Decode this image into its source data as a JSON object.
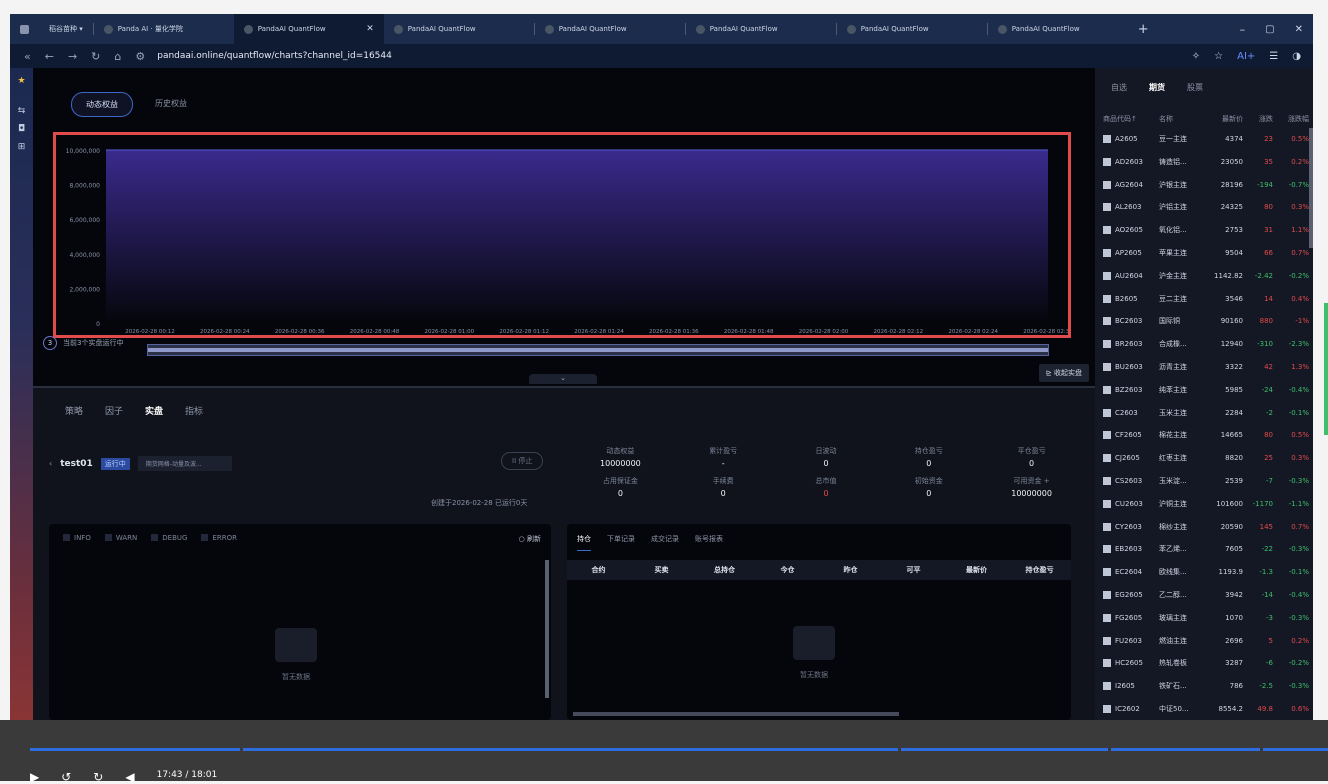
{
  "browser": {
    "tabs": [
      {
        "label": "稻谷苗种 ▾",
        "active": false
      },
      {
        "label": "Panda AI · 量化学院",
        "active": false
      },
      {
        "label": "PandaAI QuantFlow",
        "active": true
      },
      {
        "label": "PandaAI QuantFlow",
        "active": false
      },
      {
        "label": "PandaAI QuantFlow",
        "active": false
      },
      {
        "label": "PandaAI QuantFlow",
        "active": false
      },
      {
        "label": "PandaAI QuantFlow",
        "active": false
      },
      {
        "label": "PandaAI QuantFlow",
        "active": false
      }
    ],
    "url": "pandaai.online/quantflow/charts?channel_id=16544",
    "ai_label": "AI+"
  },
  "equity": {
    "toggle_dynamic": "动态权益",
    "toggle_history": "历史权益",
    "running_count": "3",
    "running_text": "当前3个实盘运行中",
    "collapse_btn": "收起实盘"
  },
  "chart_data": {
    "type": "area",
    "x": [
      "2026-02-28 00:12",
      "2026-02-28 00:24",
      "2026-02-28 00:36",
      "2026-02-28 00:48",
      "2026-02-28 01:00",
      "2026-02-28 01:12",
      "2026-02-28 01:24",
      "2026-02-28 01:36",
      "2026-02-28 01:48",
      "2026-02-28 02:00",
      "2026-02-28 02:12",
      "2026-02-28 02:24",
      "2026-02-28 02:36"
    ],
    "yticks": [
      "0",
      "2,000,000",
      "4,000,000",
      "6,000,000",
      "8,000,000",
      "10,000,000"
    ],
    "values": [
      10000000,
      10000000,
      10000000,
      10000000,
      10000000,
      10000000,
      10000000,
      10000000,
      10000000,
      10000000,
      10000000,
      10000000,
      10000000
    ],
    "ylim": [
      0,
      10000000
    ],
    "grid": false,
    "colors": {
      "fill_top": "#3a2a8c",
      "fill_bottom": "#05060b",
      "line": "#4a4fc0"
    }
  },
  "bottom": {
    "tabs": [
      "策略",
      "因子",
      "实盘",
      "指标"
    ],
    "active_tab": "实盘",
    "strategy_name": "test01",
    "status_badge": "运行中",
    "strategy_select": "期货网格-动量及波...",
    "stop_btn": "II 停止",
    "created": "创建于2026-02-28   已运行0天",
    "stats": [
      {
        "label": "动态权益",
        "value": "10000000",
        "red": false
      },
      {
        "label": "累计盈亏",
        "value": "-",
        "red": false
      },
      {
        "label": "日波动",
        "value": "0",
        "red": false
      },
      {
        "label": "持仓盈亏",
        "value": "0",
        "red": false
      },
      {
        "label": "平仓盈亏",
        "value": "0",
        "red": false
      },
      {
        "label": "占用保证金",
        "value": "0",
        "red": false
      },
      {
        "label": "手续费",
        "value": "0",
        "red": false
      },
      {
        "label": "总市值",
        "value": "0",
        "red": true
      },
      {
        "label": "初始资金",
        "value": "0",
        "red": false
      },
      {
        "label": "可用资金 +",
        "value": "10000000",
        "red": false
      }
    ],
    "log_filters": [
      "INFO",
      "WARN",
      "DEBUG",
      "ERROR"
    ],
    "refresh": "○ 刷新",
    "empty_text": "暂无数据",
    "position_tabs": [
      "持仓",
      "下单记录",
      "成交记录",
      "账号报表"
    ],
    "position_headers": [
      "合约",
      "买卖",
      "总持仓",
      "今仓",
      "昨仓",
      "可平",
      "最新价",
      "持仓盈亏"
    ]
  },
  "market": {
    "tabs": [
      "自选",
      "期货",
      "股票"
    ],
    "active_tab": "期货",
    "headers": [
      "商品代码↑",
      "名称",
      "最新价",
      "涨跌",
      "涨跌幅"
    ],
    "rows": [
      {
        "code": "A2605",
        "name": "豆一主连",
        "price": "4374",
        "chg": "23",
        "pct": "0.5%",
        "dir": "up"
      },
      {
        "code": "AD2603",
        "name": "铸造铝...",
        "price": "23050",
        "chg": "35",
        "pct": "0.2%",
        "dir": "up"
      },
      {
        "code": "AG2604",
        "name": "沪银主连",
        "price": "28196",
        "chg": "-194",
        "pct": "-0.7%",
        "dir": "dn"
      },
      {
        "code": "AL2603",
        "name": "沪铝主连",
        "price": "24325",
        "chg": "80",
        "pct": "0.3%",
        "dir": "up"
      },
      {
        "code": "AO2605",
        "name": "氧化铝...",
        "price": "2753",
        "chg": "31",
        "pct": "1.1%",
        "dir": "up"
      },
      {
        "code": "AP2605",
        "name": "苹果主连",
        "price": "9504",
        "chg": "66",
        "pct": "0.7%",
        "dir": "up"
      },
      {
        "code": "AU2604",
        "name": "沪金主连",
        "price": "1142.82",
        "chg": "-2.42",
        "pct": "-0.2%",
        "dir": "dn"
      },
      {
        "code": "B2605",
        "name": "豆二主连",
        "price": "3546",
        "chg": "14",
        "pct": "0.4%",
        "dir": "up"
      },
      {
        "code": "BC2603",
        "name": "国际铜",
        "price": "90160",
        "chg": "880",
        "pct": "-1%",
        "dir": "up"
      },
      {
        "code": "BR2603",
        "name": "合成橡...",
        "price": "12940",
        "chg": "-310",
        "pct": "-2.3%",
        "dir": "dn"
      },
      {
        "code": "BU2603",
        "name": "沥青主连",
        "price": "3322",
        "chg": "42",
        "pct": "1.3%",
        "dir": "up"
      },
      {
        "code": "BZ2603",
        "name": "纯苯主连",
        "price": "5985",
        "chg": "-24",
        "pct": "-0.4%",
        "dir": "dn"
      },
      {
        "code": "C2603",
        "name": "玉米主连",
        "price": "2284",
        "chg": "-2",
        "pct": "-0.1%",
        "dir": "dn"
      },
      {
        "code": "CF2605",
        "name": "棉花主连",
        "price": "14665",
        "chg": "80",
        "pct": "0.5%",
        "dir": "up"
      },
      {
        "code": "CJ2605",
        "name": "红枣主连",
        "price": "8820",
        "chg": "25",
        "pct": "0.3%",
        "dir": "up"
      },
      {
        "code": "CS2603",
        "name": "玉米淀...",
        "price": "2539",
        "chg": "-7",
        "pct": "-0.3%",
        "dir": "dn"
      },
      {
        "code": "CU2603",
        "name": "沪铜主连",
        "price": "101600",
        "chg": "-1170",
        "pct": "-1.1%",
        "dir": "dn"
      },
      {
        "code": "CY2603",
        "name": "棉纱主连",
        "price": "20590",
        "chg": "145",
        "pct": "0.7%",
        "dir": "up"
      },
      {
        "code": "EB2603",
        "name": "苯乙烯...",
        "price": "7605",
        "chg": "-22",
        "pct": "-0.3%",
        "dir": "dn"
      },
      {
        "code": "EC2604",
        "name": "欧线集...",
        "price": "1193.9",
        "chg": "-1.3",
        "pct": "-0.1%",
        "dir": "dn"
      },
      {
        "code": "EG2605",
        "name": "乙二醇...",
        "price": "3942",
        "chg": "-14",
        "pct": "-0.4%",
        "dir": "dn"
      },
      {
        "code": "FG2605",
        "name": "玻璃主连",
        "price": "1070",
        "chg": "-3",
        "pct": "-0.3%",
        "dir": "dn"
      },
      {
        "code": "FU2603",
        "name": "燃油主连",
        "price": "2696",
        "chg": "5",
        "pct": "0.2%",
        "dir": "up"
      },
      {
        "code": "HC2605",
        "name": "热轧卷板",
        "price": "3287",
        "chg": "-6",
        "pct": "-0.2%",
        "dir": "dn"
      },
      {
        "code": "I2605",
        "name": "铁矿石...",
        "price": "786",
        "chg": "-2.5",
        "pct": "-0.3%",
        "dir": "dn"
      },
      {
        "code": "IC2602",
        "name": "中证50...",
        "price": "8554.2",
        "chg": "49.8",
        "pct": "0.6%",
        "dir": "up"
      },
      {
        "code": "IF2602",
        "name": "沪深30...",
        "price": "4714.8",
        "chg": "-7.6",
        "pct": "-0.2%",
        "dir": "dn"
      }
    ]
  },
  "player": {
    "time": "17:43 / 18:01"
  }
}
